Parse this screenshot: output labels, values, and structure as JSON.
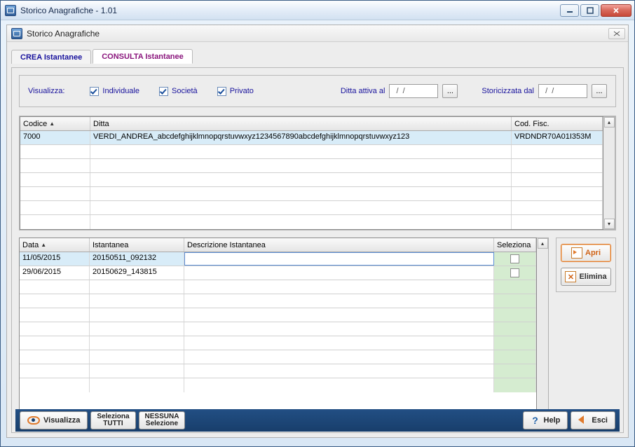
{
  "window": {
    "title": "Storico Anagrafiche - 1.01",
    "inner_title": "Storico Anagrafiche"
  },
  "tabs": {
    "crea": "CREA Istantanee",
    "consulta": "CONSULTA Istantanee"
  },
  "filters": {
    "visualizza": "Visualizza:",
    "individuale": "Individuale",
    "societa": "Società",
    "privato": "Privato",
    "ditta_attiva": "Ditta attiva al",
    "storicizzata": "Storicizzata dal",
    "date1": "  /  /",
    "date2": "  /  /"
  },
  "grid1": {
    "headers": {
      "codice": "Codice",
      "ditta": "Ditta",
      "cod_fisc": "Cod. Fisc."
    },
    "rows": [
      {
        "codice": "7000",
        "ditta": "VERDI_ANDREA_abcdefghijklmnopqrstuvwxyz1234567890abcdefghijklmnopqrstuvwxyz123",
        "cod_fisc": "VRDNDR70A01I353M"
      }
    ]
  },
  "grid2": {
    "headers": {
      "data": "Data",
      "istantanea": "Istantanea",
      "descrizione": "Descrizione Istantanea",
      "seleziona": "Seleziona"
    },
    "rows": [
      {
        "data": "11/05/2015",
        "istantanea": "20150511_092132",
        "descrizione": "",
        "selected": true
      },
      {
        "data": "29/06/2015",
        "istantanea": "20150629_143815",
        "descrizione": "",
        "selected": false
      }
    ]
  },
  "side": {
    "apri": "Apri",
    "elimina": "Elimina"
  },
  "bottom": {
    "visualizza": "Visualizza",
    "seleziona_t1": "Seleziona",
    "seleziona_t2": "TUTTI",
    "nessuna_t1": "NESSUNA",
    "nessuna_t2": "Selezione",
    "help": "Help",
    "esci": "Esci"
  },
  "misc": {
    "ellipsis": "...",
    "sort_asc": "▲"
  }
}
